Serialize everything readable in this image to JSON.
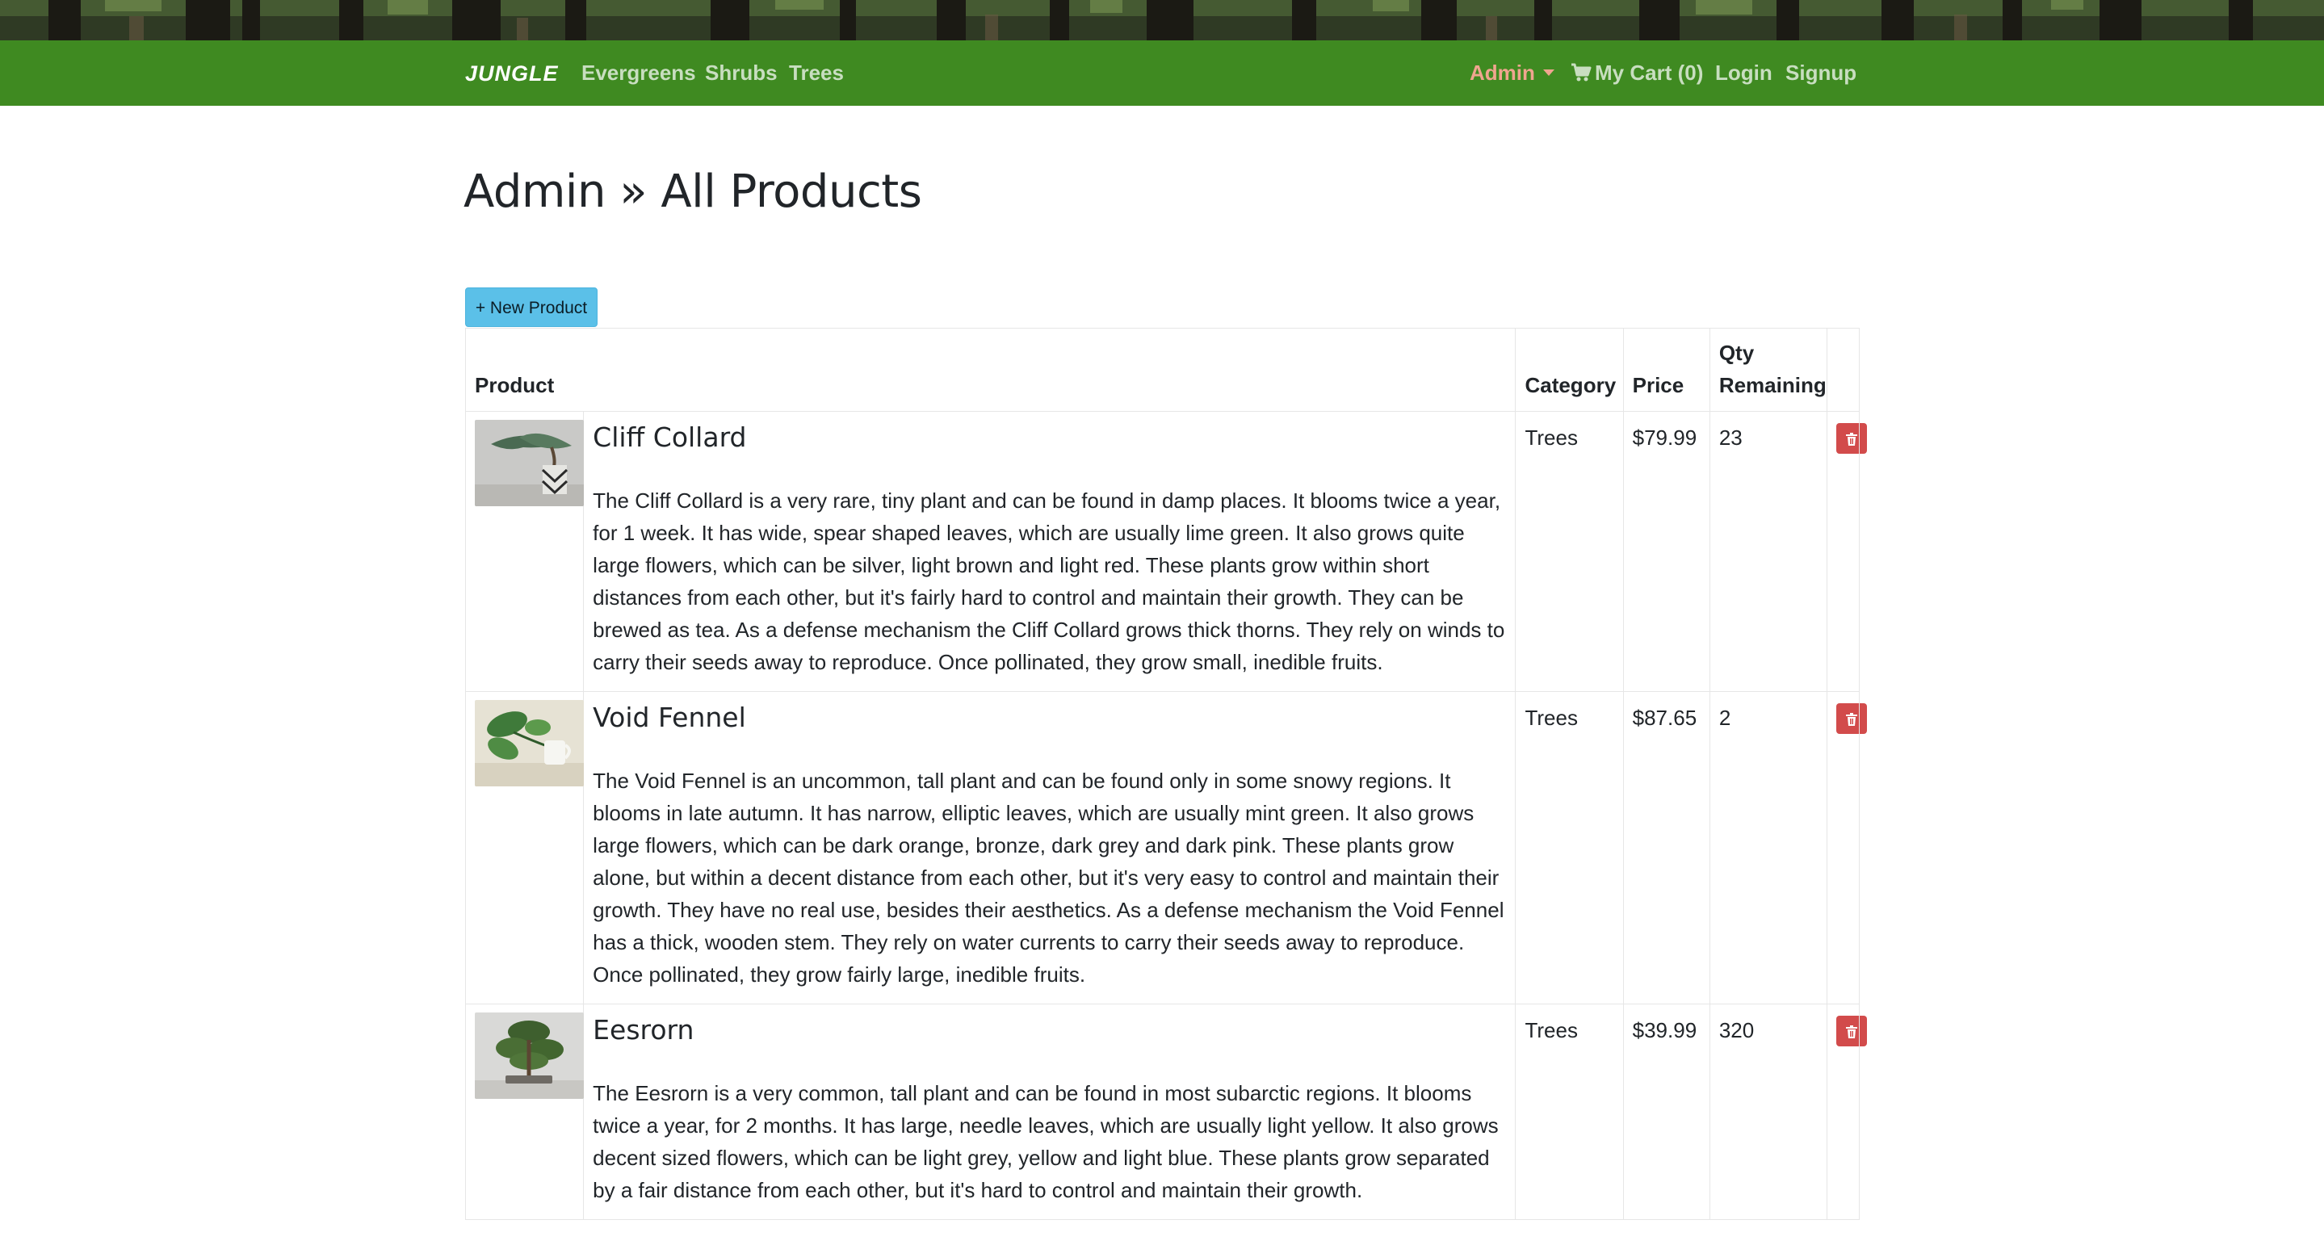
{
  "nav": {
    "brand": "JUNGLE",
    "links": [
      "Evergreens",
      "Shrubs",
      "Trees"
    ],
    "admin": "Admin",
    "cart": "My Cart (0)",
    "login": "Login",
    "signup": "Signup"
  },
  "colors": {
    "nav_bg": "#3f8a21",
    "admin_link": "#f0a58f",
    "new_button": "#5bc0e8",
    "delete_button": "#d24b4b"
  },
  "page": {
    "title": "Admin » All Products",
    "new_button": "+ New Product"
  },
  "table": {
    "headers": {
      "product": "Product",
      "category": "Category",
      "price": "Price",
      "qty": "Qty Remaining"
    },
    "rows": [
      {
        "name": "Cliff Collard",
        "description": "The Cliff Collard is a very rare, tiny plant and can be found in damp places. It blooms twice a year, for 1 week. It has wide, spear shaped leaves, which are usually lime green. It also grows quite large flowers, which can be silver, light brown and light red. These plants grow within short distances from each other, but it's fairly hard to control and maintain their growth. They can be brewed as tea. As a defense mechanism the Cliff Collard grows thick thorns. They rely on winds to carry their seeds away to reproduce. Once pollinated, they grow small, inedible fruits.",
        "category": "Trees",
        "price": "$79.99",
        "qty": "23",
        "image": "bonsai-in-geometric-pot"
      },
      {
        "name": "Void Fennel",
        "description": "The Void Fennel is an uncommon, tall plant and can be found only in some snowy regions. It blooms in late autumn. It has narrow, elliptic leaves, which are usually mint green. It also grows large flowers, which can be dark orange, bronze, dark grey and dark pink. These plants grow alone, but within a decent distance from each other, but it's very easy to control and maintain their growth. They have no real use, besides their aesthetics. As a defense mechanism the Void Fennel has a thick, wooden stem. They rely on water currents to carry their seeds away to reproduce. Once pollinated, they grow fairly large, inedible fruits.",
        "category": "Trees",
        "price": "$87.65",
        "qty": "2",
        "image": "pothos-in-white-mug"
      },
      {
        "name": "Eesrorn",
        "description": "The Eesrorn is a very common, tall plant and can be found in most subarctic regions. It blooms twice a year, for 2 months. It has large, needle leaves, which are usually light yellow. It also grows decent sized flowers, which can be light grey, yellow and light blue. These plants grow separated by a fair distance from each other, but it's hard to control and maintain their growth.",
        "category": "Trees",
        "price": "$39.99",
        "qty": "320",
        "image": "bonsai-tree"
      }
    ]
  }
}
